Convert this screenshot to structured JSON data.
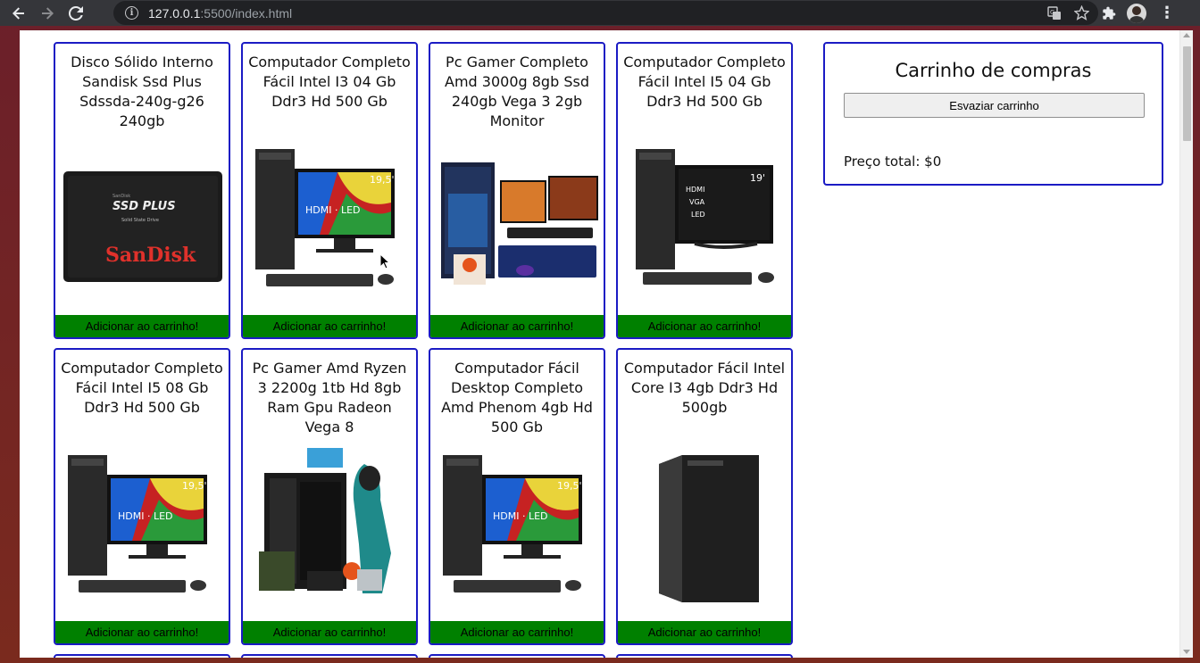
{
  "browser": {
    "url_host": "127.0.0.1",
    "url_rest": ":5500/index.html",
    "back_icon": "arrow-left-icon",
    "forward_icon": "arrow-right-icon",
    "reload_icon": "reload-icon"
  },
  "products": [
    {
      "title": "Disco Sólido Interno Sandisk Ssd Plus Sdssda-240g-g26 240gb",
      "image": "ssd",
      "button": "Adicionar ao carrinho!"
    },
    {
      "title": "Computador Completo Fácil Intel I3 04 Gb Ddr3 Hd 500 Gb",
      "image": "pc-colorful",
      "button": "Adicionar ao carrinho!"
    },
    {
      "title": "Pc Gamer Completo Amd 3000g 8gb Ssd 240gb Vega 3 2gb Monitor",
      "image": "gamer-setup",
      "button": "Adicionar ao carrinho!"
    },
    {
      "title": "Computador Completo Fácil Intel I5 04 Gb Ddr3 Hd 500 Gb",
      "image": "pc-black",
      "button": "Adicionar ao carrinho!"
    },
    {
      "title": "Computador Completo Fácil Intel I5 08 Gb Ddr3 Hd 500 Gb",
      "image": "pc-colorful",
      "button": "Adicionar ao carrinho!"
    },
    {
      "title": "Pc Gamer Amd Ryzen 3 2200g 1tb Hd 8gb Ram Gpu Radeon Vega 8",
      "image": "gamer-tower",
      "button": "Adicionar ao carrinho!"
    },
    {
      "title": "Computador Fácil Desktop Completo Amd Phenom 4gb Hd 500 Gb",
      "image": "pc-colorful",
      "button": "Adicionar ao carrinho!"
    },
    {
      "title": "Computador Fácil Intel Core I3 4gb Ddr3 Hd 500gb",
      "image": "tower",
      "button": "Adicionar ao carrinho!"
    }
  ],
  "cart": {
    "title": "Carrinho de compras",
    "empty_button": "Esvaziar carrinho",
    "total_label": "Preço total: $0"
  },
  "colors": {
    "card_border": "#1b1bc4",
    "button_green": "#008000"
  }
}
